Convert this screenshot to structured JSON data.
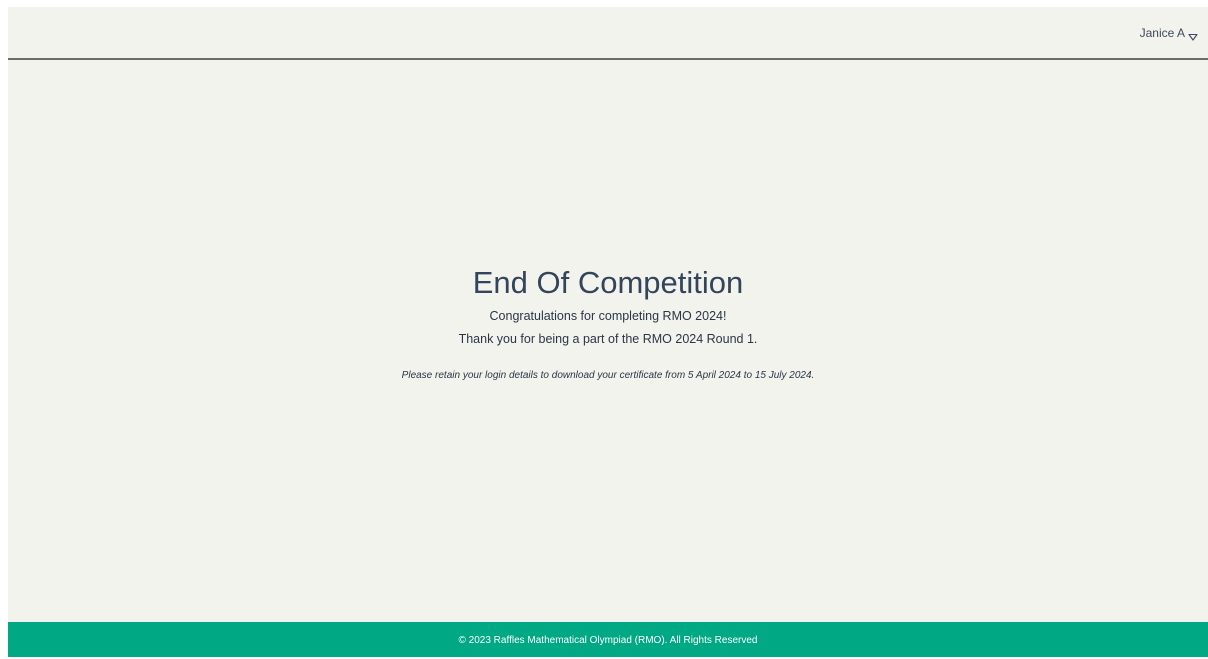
{
  "header": {
    "user_name": "Janice A",
    "menu_icon": "chevron-down-outline-icon"
  },
  "main": {
    "title": "End Of Competition",
    "congrats": "Congratulations for completing RMO 2024!",
    "thanks": "Thank you for being a part of the RMO 2024 Round 1.",
    "note": "Please retain your login details to download your certificate from 5 April 2024 to 15 July 2024."
  },
  "footer": {
    "copyright": "© 2023 Raffles Mathematical Olympiad (RMO). All Rights Reserved"
  },
  "colors": {
    "background": "#f3f3ee",
    "footer": "#00a884",
    "text": "#34445a"
  }
}
